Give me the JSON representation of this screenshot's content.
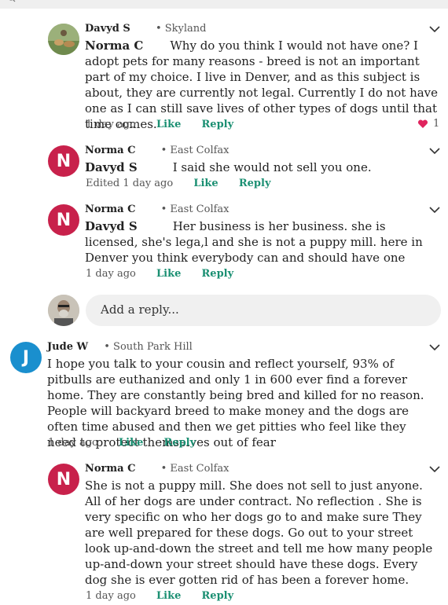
{
  "comments": [
    {
      "author": "Davyd S",
      "location": "• Skyland",
      "mention": "Norma C",
      "text": "Why do you think I would not have one?  I adopt pets for many reasons - breed is not an important part of my choice.  I live in Denver, and as this subject is about, they are currently not legal.  Currently I do not have one as I can still save lives of other types of dogs until that time comes.",
      "time": "1 day ago",
      "like": "Like",
      "reply": "Reply",
      "like_count": "1"
    },
    {
      "author": "Norma C",
      "location": "• East Colfax",
      "mention": "Davyd S",
      "text": "I said she would not sell you one.",
      "time": "Edited 1 day ago",
      "like": "Like",
      "reply": "Reply"
    },
    {
      "author": "Norma C",
      "location": "• East Colfax",
      "mention": "Davyd S",
      "text": "Her business is her business. she is licensed, she's lega,l and she is not a puppy mill.   here in Denver you think everybody can and should have one",
      "time": "1 day ago",
      "like": "Like",
      "reply": "Reply"
    },
    {
      "author": "Jude W",
      "location": "• South Park Hill",
      "text": "I hope you talk to your cousin and reflect yourself, 93% of pitbulls are euthanized and only 1 in 600 ever find a forever home. They are constantly being bred and killed for no reason. People will backyard breed to make money and the dogs are often time abused and then we get pitties who feel like they need to protect themselves out of fear",
      "time": "1 day ago",
      "like": "Like",
      "reply": "Reply",
      "avatar_letter": "J"
    },
    {
      "author": "Norma C",
      "location": "• East Colfax",
      "text": "She is not a puppy mill. She does not sell to just anyone. All of her dogs are under contract. No reflection . She is very specific on who her dogs go to and make sure They are well prepared for these dogs. Go out to your street look up-and-down the street and tell me how many people up-and-down your street should have these dogs. Every dog she is ever gotten rid of has been a forever home.",
      "time": "1 day ago",
      "like": "Like",
      "reply": "Reply",
      "avatar_letter": "N"
    }
  ],
  "avatar_letter_n": "N",
  "reply_placeholder": "Add a reply...",
  "colors": {
    "accent": "#1a8f72",
    "avatar_n": "#c8214b",
    "avatar_j": "#1a8fce",
    "heart": "#e0245e"
  },
  "icons": [
    "search-icon",
    "chevron-down-icon",
    "heart-icon"
  ]
}
